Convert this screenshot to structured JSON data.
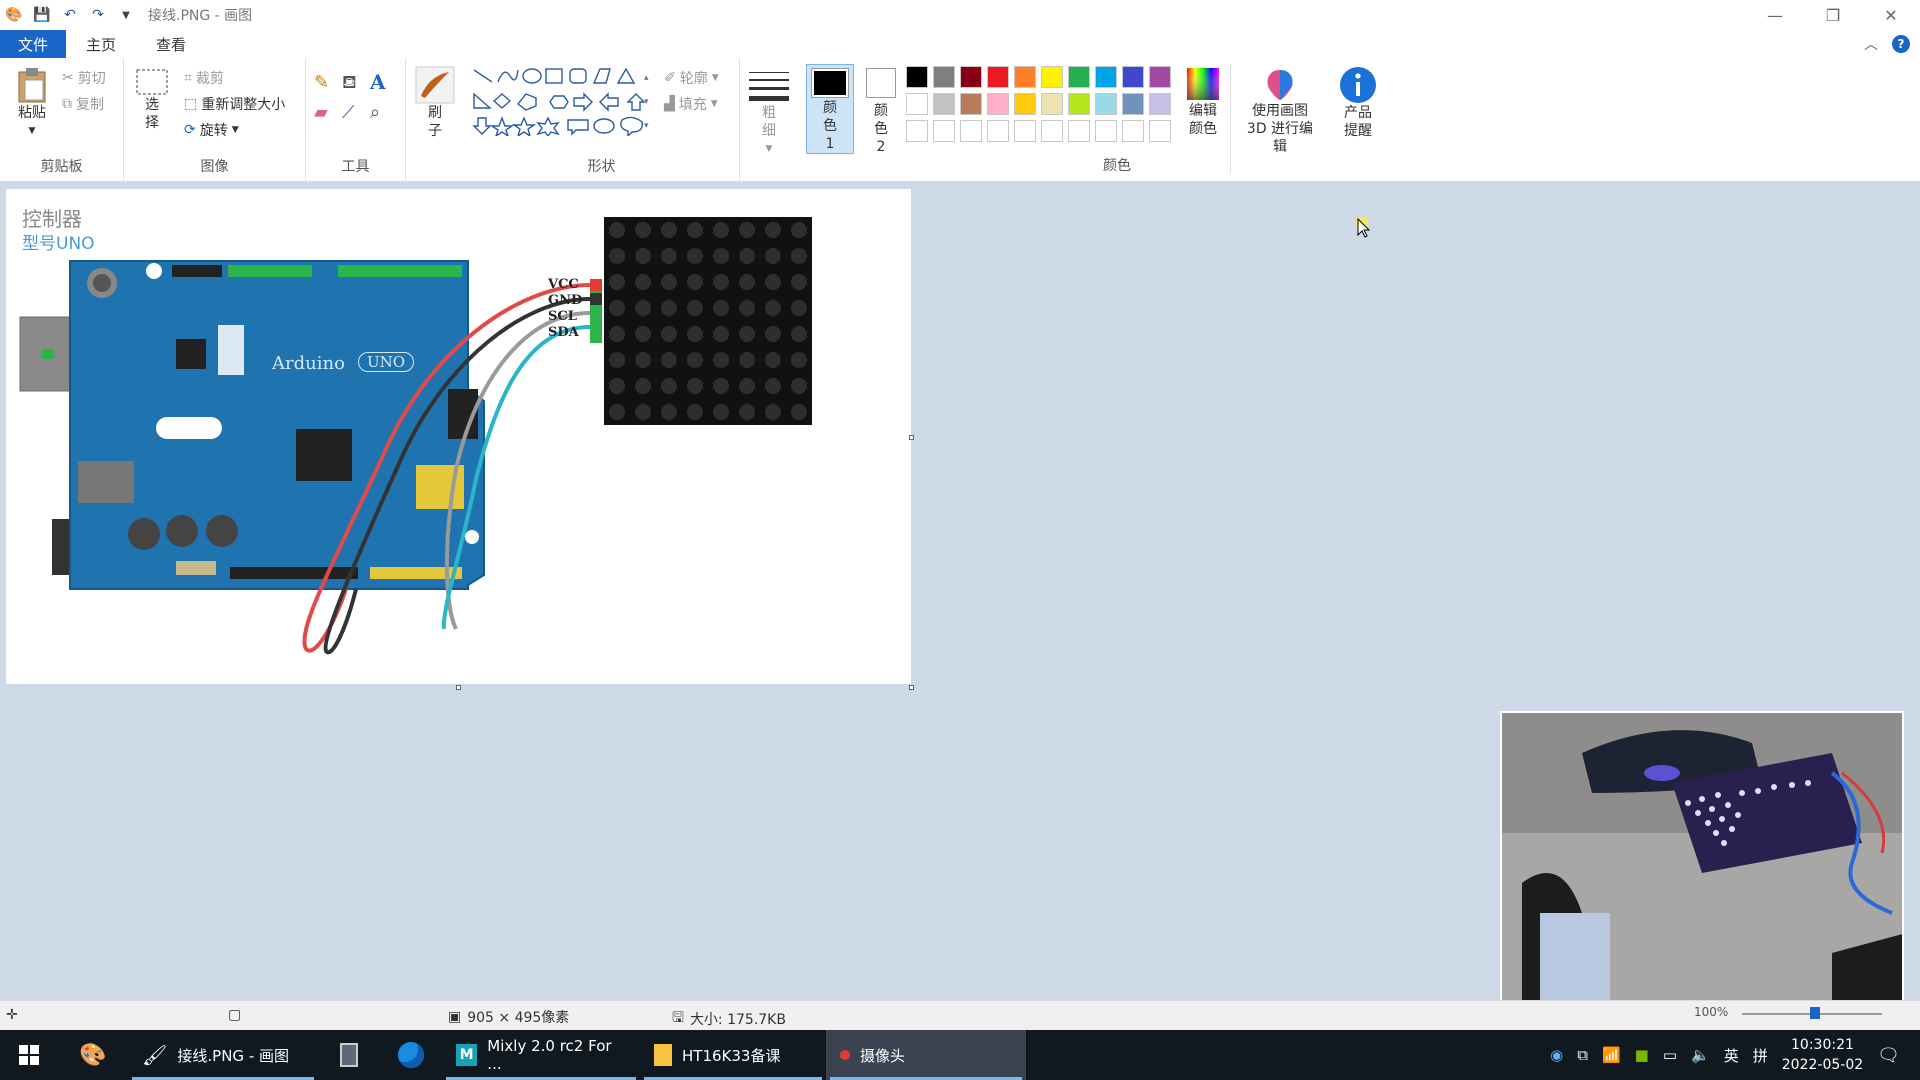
{
  "title_bar": {
    "title": "接线.PNG - 画图",
    "quick_access": [
      "save-icon",
      "undo-icon",
      "redo-icon",
      "customize-icon"
    ]
  },
  "tabs": [
    {
      "label": "文件",
      "active": true
    },
    {
      "label": "主页"
    },
    {
      "label": "查看"
    }
  ],
  "ribbon": {
    "clipboard": {
      "label": "剪贴板",
      "paste": "粘贴",
      "cut": "剪切",
      "copy": "复制"
    },
    "image": {
      "label": "图像",
      "select": "选择",
      "crop": "裁剪",
      "resize": "重新调整大小",
      "rotate": "旋转"
    },
    "tools": {
      "label": "工具"
    },
    "brushes": {
      "label": "刷子"
    },
    "shapes": {
      "label": "形状",
      "outline": "轮廓",
      "fill": "填充"
    },
    "size": {
      "label": "粗细"
    },
    "color1": {
      "label": "颜色 1",
      "value": "#000000"
    },
    "color2": {
      "label": "颜色 2",
      "value": "#ffffff"
    },
    "colors": {
      "label": "颜色",
      "palette_row1": [
        "#000000",
        "#7f7f7f",
        "#880015",
        "#ed1c24",
        "#ff7f27",
        "#fff200",
        "#22b14c",
        "#00a2e8",
        "#3f48cc",
        "#a349a4"
      ],
      "palette_row2": [
        "#ffffff",
        "#c3c3c3",
        "#b97a57",
        "#ffaec9",
        "#ffc90e",
        "#efe4b0",
        "#b5e61d",
        "#99d9ea",
        "#7092be",
        "#c8bfe7"
      ],
      "edit": "编辑颜色"
    },
    "paint3d": "使用画图 3D 进行编辑",
    "product_alert": "产品提醒"
  },
  "canvas": {
    "heading": "控制器",
    "subheading": "型号UNO",
    "board_text": "Arduino",
    "board_model": "UNO",
    "pins": [
      "VCC",
      "GND",
      "SCL",
      "SDA"
    ]
  },
  "status": {
    "dimensions": "905 × 495像素",
    "size": "大小: 175.7KB",
    "zoom": "100%"
  },
  "taskbar": {
    "items": [
      {
        "label": "接线.PNG - 画图",
        "active": false
      },
      {
        "label": "Mixly 2.0 rc2 For ...",
        "active": false
      },
      {
        "label": "HT16K33备课",
        "active": false
      },
      {
        "label": "摄像头",
        "active": true
      }
    ],
    "lang": "英",
    "ime": "拼",
    "time": "10:30:21",
    "date": "2022-05-02"
  }
}
